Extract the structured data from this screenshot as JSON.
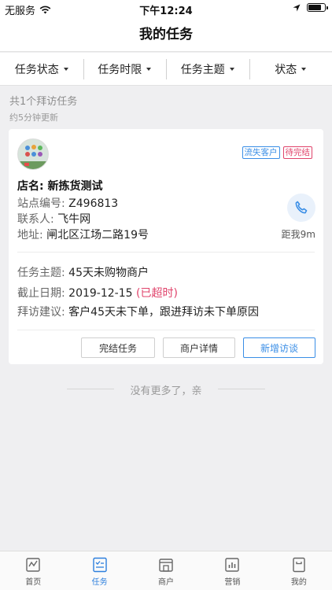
{
  "status_bar": {
    "carrier": "无服务",
    "time": "下午12:24",
    "battery_level": 0.85
  },
  "nav": {
    "title": "我的任务"
  },
  "filters": [
    {
      "label": "任务状态"
    },
    {
      "label": "任务时限"
    },
    {
      "label": "任务主题"
    },
    {
      "label": "状态"
    }
  ],
  "list": {
    "summary": "共1个拜访任务",
    "updated": "约5分钟更新",
    "no_more": "没有更多了，亲"
  },
  "task": {
    "tags": {
      "lost": "流失客户",
      "pending": "待完结"
    },
    "shop_name_label": "店名:",
    "shop_name": "新拣货测试",
    "site_label": "站点编号:",
    "site_code": "Z496813",
    "contact_label": "联系人:",
    "contact": "飞牛网",
    "address_label": "地址:",
    "address": "闸北区江场二路19号",
    "distance": "距我9m",
    "topic_label": "任务主题:",
    "topic": "45天未购物商户",
    "deadline_label": "截止日期:",
    "deadline": "2019-12-15",
    "overdue": "(已超时)",
    "advice_label": "拜访建议:",
    "advice": "客户45天未下单，跟进拜访未下单原因",
    "actions": {
      "finish": "完结任务",
      "detail": "商户详情",
      "new_visit": "新增访谈"
    }
  },
  "tabs": [
    {
      "label": "首页",
      "icon": "home-icon"
    },
    {
      "label": "任务",
      "icon": "task-list-icon",
      "active": true
    },
    {
      "label": "商户",
      "icon": "store-icon"
    },
    {
      "label": "营销",
      "icon": "chart-icon"
    },
    {
      "label": "我的",
      "icon": "profile-icon"
    }
  ],
  "colors": {
    "accent": "#2d7fdd",
    "alert": "#e0436b",
    "tag_blue": "#3a8ee6"
  }
}
